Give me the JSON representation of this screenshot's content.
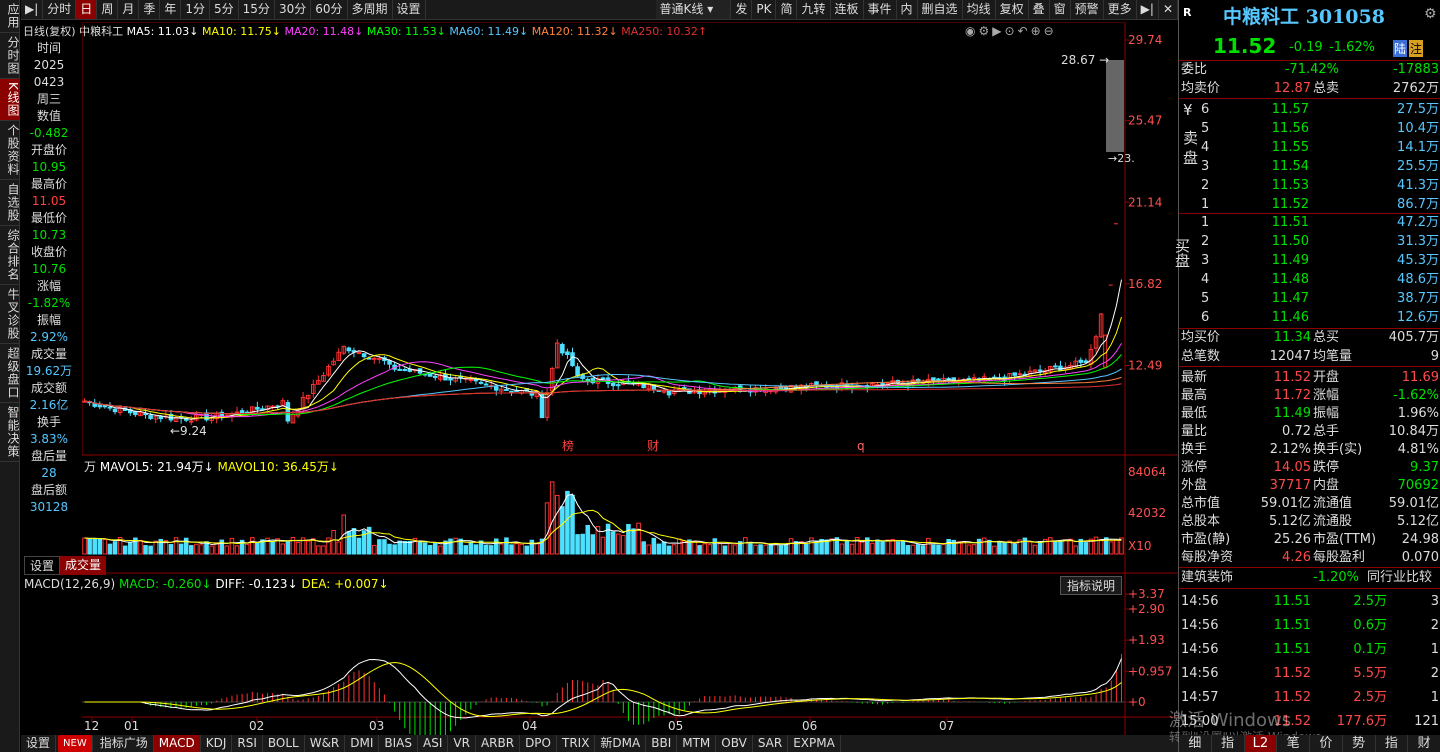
{
  "vtabs": [
    "应用",
    "分时图",
    "K线图",
    "个股资料",
    "自选股",
    "综合排名",
    "牛叉诊股",
    "超级盘口",
    "智能决策"
  ],
  "toolbar": [
    "分时",
    "日",
    "周",
    "月",
    "季",
    "年",
    "1分",
    "5分",
    "15分",
    "30分",
    "60分",
    "多周期",
    "设置"
  ],
  "toolbar_right": [
    "发",
    "PK",
    "简",
    "九转",
    "连板",
    "事件",
    "内",
    "删自选",
    "均线",
    "复权",
    "叠",
    "窗",
    "预警",
    "更多"
  ],
  "kline_type": "普通K线",
  "ma_header": {
    "period": "日线(复权)",
    "name": "中粮科工",
    "ma5": "MA5: 11.03↓",
    "ma10": "MA10: 11.75↓",
    "ma20": "MA20: 11.48↓",
    "ma30": "MA30: 11.53↓",
    "ma60": "MA60: 11.49↓",
    "ma120": "MA120: 11.32↓",
    "ma250": "MA250: 10.32↑"
  },
  "datawin": [
    {
      "k": "时间",
      "v": "2025",
      "c": "wht"
    },
    {
      "k": "",
      "v": "0423",
      "c": "wht"
    },
    {
      "k": "",
      "v": "周三",
      "c": "wht"
    },
    {
      "k": "数值",
      "v": "-0.482",
      "c": "grn"
    },
    {
      "k": "开盘价",
      "v": "10.95",
      "c": "grn"
    },
    {
      "k": "最高价",
      "v": "11.05",
      "c": "red"
    },
    {
      "k": "最低价",
      "v": "10.73",
      "c": "grn"
    },
    {
      "k": "收盘价",
      "v": "10.76",
      "c": "grn"
    },
    {
      "k": "涨幅",
      "v": "-1.82%",
      "c": "grn"
    },
    {
      "k": "振幅",
      "v": "2.92%",
      "c": "cyan"
    },
    {
      "k": "成交量",
      "v": "19.62万",
      "c": "cyan"
    },
    {
      "k": "成交额",
      "v": "2.16亿",
      "c": "cyan"
    },
    {
      "k": "换手",
      "v": "3.83%",
      "c": "cyan"
    },
    {
      "k": "盘后量",
      "v": "28",
      "c": "cyan"
    },
    {
      "k": "盘后额",
      "v": "30128",
      "c": "cyan"
    }
  ],
  "price_axis": [
    "29.74",
    "25.47",
    "21.14",
    "16.82",
    "12.49"
  ],
  "price_marks": {
    "high": "28.67",
    "low": "9.24",
    "cut": "23."
  },
  "events": [
    "榜",
    "财",
    "q"
  ],
  "vol_header": {
    "unit": "万",
    "mavol5": "MAVOL5: 21.94万↓",
    "mavol10": "MAVOL10: 36.45万↓"
  },
  "vol_axis": [
    "84064",
    "42032",
    "X10"
  ],
  "vol_tabs": [
    "设置",
    "成交量"
  ],
  "macd_header": {
    "name": "MACD(12,26,9)",
    "macd": "MACD: -0.260↓",
    "diff": "DIFF: -0.123↓",
    "dea": "DEA: +0.007↓"
  },
  "macd_btn": "指标说明",
  "macd_axis": [
    "+3.37",
    "+2.90",
    "+1.93",
    "+0.957",
    "+0"
  ],
  "x_axis": [
    "12",
    "01",
    "02",
    "03",
    "04",
    "05",
    "06",
    "07"
  ],
  "btabs": [
    "设置",
    "NEW",
    "指标广场",
    "MACD",
    "KDJ",
    "RSI",
    "BOLL",
    "W&R",
    "DMI",
    "BIAS",
    "ASI",
    "VR",
    "ARBR",
    "DPO",
    "TRIX",
    "新DMA",
    "BBI",
    "MTM",
    "OBV",
    "SAR",
    "EXPMA"
  ],
  "quote": {
    "logo": "R",
    "name": "中粮科工",
    "code": "301058",
    "price": "11.52",
    "chg": "-0.19",
    "pct": "-1.62%",
    "tag1": "陆",
    "tag2": "注"
  },
  "wb": {
    "k1": "委比",
    "v1": "-71.42%",
    "v2": "-17883",
    "k3": "均卖价",
    "v3": "12.87",
    "k4": "总卖",
    "v4": "2762万"
  },
  "sell": [
    [
      "6",
      "11.57",
      "27.5万"
    ],
    [
      "5",
      "11.56",
      "10.4万"
    ],
    [
      "4",
      "11.55",
      "14.1万"
    ],
    [
      "3",
      "11.54",
      "25.5万"
    ],
    [
      "2",
      "11.53",
      "41.3万"
    ],
    [
      "1",
      "11.52",
      "86.7万"
    ]
  ],
  "buy": [
    [
      "1",
      "11.51",
      "47.2万"
    ],
    [
      "2",
      "11.50",
      "31.3万"
    ],
    [
      "3",
      "11.49",
      "45.3万"
    ],
    [
      "4",
      "11.48",
      "48.6万"
    ],
    [
      "5",
      "11.47",
      "38.7万"
    ],
    [
      "6",
      "11.46",
      "12.6万"
    ]
  ],
  "sell_label": "卖盘",
  "buy_label": "买盘",
  "yen": "¥",
  "buysum": {
    "k1": "均买价",
    "v1": "11.34",
    "k2": "总买",
    "v2": "405.7万",
    "k3": "总笔数",
    "v3": "12047",
    "k4": "均笔量",
    "v4": "9"
  },
  "stats": [
    [
      "最新",
      "11.52",
      "red",
      "开盘",
      "11.69",
      "red"
    ],
    [
      "最高",
      "11.72",
      "red",
      "涨幅",
      "-1.62%",
      "grn"
    ],
    [
      "最低",
      "11.49",
      "grn",
      "振幅",
      "1.96%",
      "wht"
    ],
    [
      "量比",
      "0.72",
      "wht",
      "总手",
      "10.84万",
      "wht"
    ],
    [
      "换手",
      "2.12%",
      "wht",
      "换手(实)",
      "4.81%",
      "wht"
    ],
    [
      "涨停",
      "14.05",
      "red",
      "跌停",
      "9.37",
      "grn"
    ],
    [
      "外盘",
      "37717",
      "red",
      "内盘",
      "70692",
      "grn"
    ],
    [
      "总市值",
      "59.01亿",
      "wht",
      "流通值",
      "59.01亿",
      "wht"
    ],
    [
      "总股本",
      "5.12亿",
      "wht",
      "流通股",
      "5.12亿",
      "wht"
    ],
    [
      "市盈(静)",
      "25.26",
      "wht",
      "市盈(TTM)",
      "24.98",
      "wht"
    ],
    [
      "每股净资",
      "4.26",
      "red",
      "每股盈利",
      "0.070",
      "wht"
    ]
  ],
  "industry": {
    "name": "建筑装饰",
    "pct": "-1.20%",
    "btn": "同行业比较"
  },
  "ticks": [
    [
      "14:56",
      "11.51",
      "2.5万",
      "3",
      "grn"
    ],
    [
      "14:56",
      "11.51",
      "0.6万",
      "2",
      "grn"
    ],
    [
      "14:56",
      "11.51",
      "0.1万",
      "1",
      "grn"
    ],
    [
      "14:56",
      "11.52",
      "5.5万",
      "2",
      "red"
    ],
    [
      "14:57",
      "11.52",
      "2.5万",
      "1",
      "red"
    ],
    [
      "15:00",
      "11.52",
      "177.6万",
      "121",
      "red"
    ]
  ],
  "rp_tabs": [
    "细",
    "指",
    "L2",
    "笔",
    "价",
    "势",
    "指",
    "财"
  ],
  "watermark": "激活 Windows",
  "watermark2": "转到\"设置\"以激活 Windows。"
}
